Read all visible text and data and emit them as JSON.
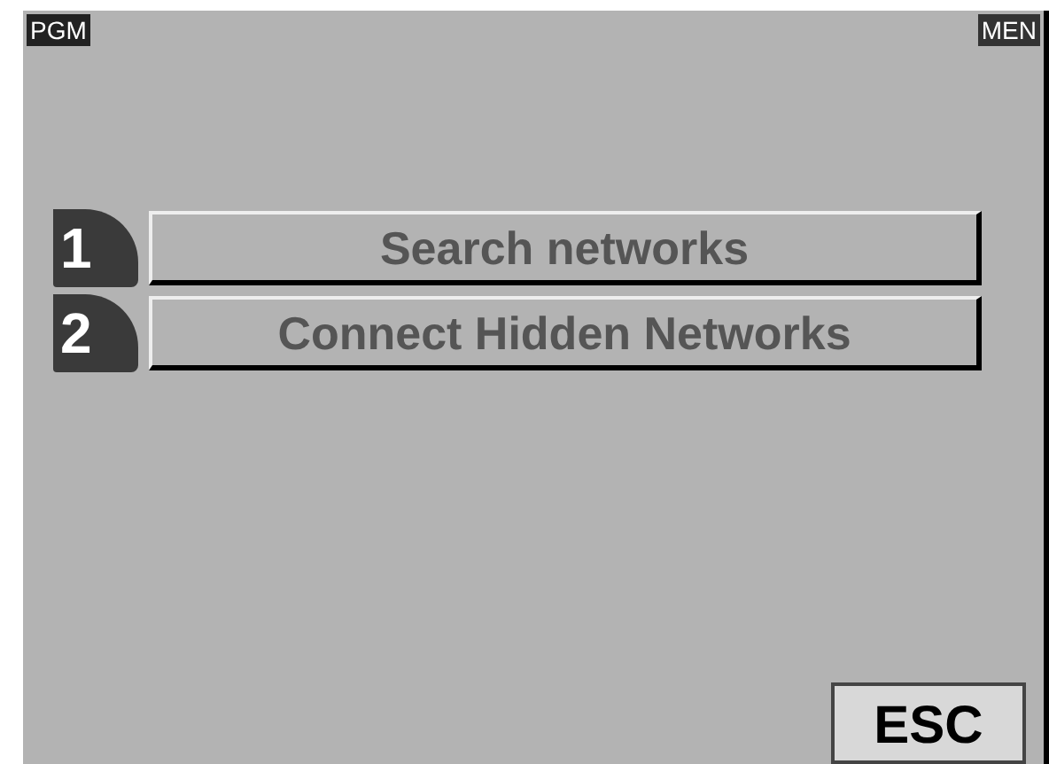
{
  "header": {
    "left_label": "PGM",
    "right_label": "MEN"
  },
  "menu_items": [
    {
      "number": "1",
      "label": "Search networks"
    },
    {
      "number": "2",
      "label": "Connect Hidden Networks"
    }
  ],
  "esc_button": "ESC"
}
